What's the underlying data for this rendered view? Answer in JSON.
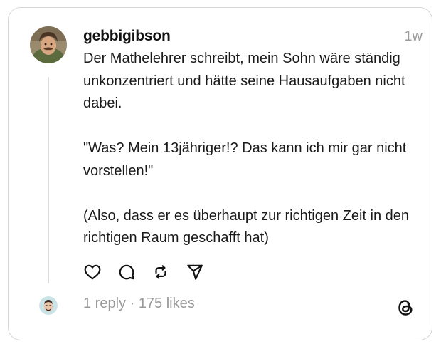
{
  "post": {
    "username": "gebbigibson",
    "timestamp": "1w",
    "paragraphs": [
      "Der Mathelehrer schreibt, mein Sohn wäre ständig unkonzentriert und hätte seine Hausaufgaben nicht dabei.",
      "\"Was? Mein 13jähriger!? Das kann ich mir gar nicht vorstellen!\"",
      "(Also, dass er es überhaupt zur richtigen Zeit in den richtigen Raum geschafft hat)"
    ]
  },
  "actions": {
    "icons": [
      "heart-icon",
      "comment-icon",
      "repost-icon",
      "share-icon"
    ]
  },
  "stats": {
    "replies": "1 reply",
    "separator": " · ",
    "likes": "175 likes"
  },
  "colors": {
    "text": "#1a1a1a",
    "muted": "#999999",
    "border": "#d6d6d6",
    "thread_line": "#dcdcdc"
  }
}
